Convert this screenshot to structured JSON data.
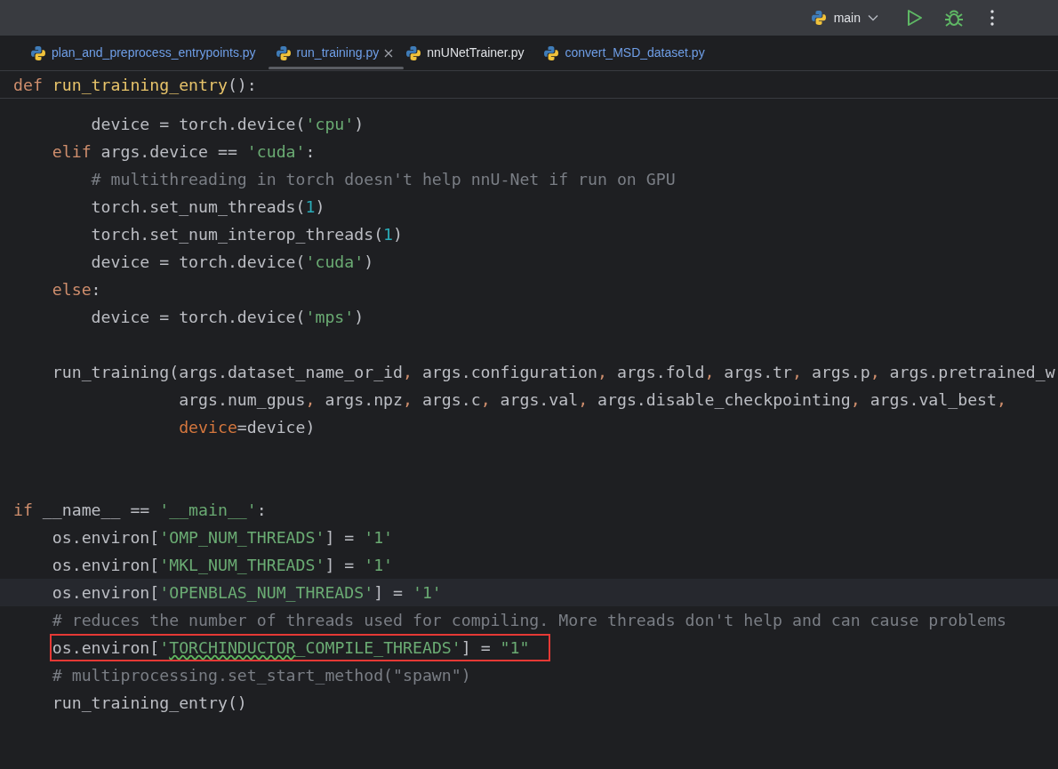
{
  "toolbar": {
    "run_config": "main"
  },
  "tabs": [
    {
      "label": "plan_and_preprocess_entrypoints.py",
      "selected": false,
      "closable": false,
      "color": "#6f9fe8"
    },
    {
      "label": "run_training.py",
      "selected": true,
      "closable": true,
      "color": "#6f9fe8"
    },
    {
      "label": "nnUNetTrainer.py",
      "selected": false,
      "closable": false,
      "color": "#dfe1e5"
    },
    {
      "label": "convert_MSD_dataset.py",
      "selected": false,
      "closable": false,
      "color": "#6f9fe8"
    }
  ],
  "sticky_header": [
    {
      "kind": "kw",
      "text": "def"
    },
    {
      "kind": "fn",
      "text": " run_training_entry"
    },
    {
      "kind": "plain",
      "text": "():"
    }
  ],
  "code_lines": [
    {
      "current": false,
      "boxed": false,
      "tokens": [
        {
          "kind": "plain",
          "text": "        device = torch.device("
        },
        {
          "kind": "str",
          "text": "'cpu'"
        },
        {
          "kind": "plain",
          "text": ")"
        }
      ]
    },
    {
      "current": false,
      "boxed": false,
      "tokens": [
        {
          "kind": "kw",
          "text": "    elif"
        },
        {
          "kind": "plain",
          "text": " args.device == "
        },
        {
          "kind": "str",
          "text": "'cuda'"
        },
        {
          "kind": "plain",
          "text": ":"
        }
      ]
    },
    {
      "current": false,
      "boxed": false,
      "tokens": [
        {
          "kind": "comment",
          "text": "        # multithreading in torch doesn't help nnU-Net if run on GPU"
        }
      ]
    },
    {
      "current": false,
      "boxed": false,
      "tokens": [
        {
          "kind": "plain",
          "text": "        torch.set_num_threads("
        },
        {
          "kind": "num",
          "text": "1"
        },
        {
          "kind": "plain",
          "text": ")"
        }
      ]
    },
    {
      "current": false,
      "boxed": false,
      "tokens": [
        {
          "kind": "plain",
          "text": "        torch.set_num_interop_threads("
        },
        {
          "kind": "num",
          "text": "1"
        },
        {
          "kind": "plain",
          "text": ")"
        }
      ]
    },
    {
      "current": false,
      "boxed": false,
      "tokens": [
        {
          "kind": "plain",
          "text": "        device = torch.device("
        },
        {
          "kind": "str",
          "text": "'cuda'"
        },
        {
          "kind": "plain",
          "text": ")"
        }
      ]
    },
    {
      "current": false,
      "boxed": false,
      "tokens": [
        {
          "kind": "kw",
          "text": "    else"
        },
        {
          "kind": "plain",
          "text": ":"
        }
      ]
    },
    {
      "current": false,
      "boxed": false,
      "tokens": [
        {
          "kind": "plain",
          "text": "        device = torch.device("
        },
        {
          "kind": "str",
          "text": "'mps'"
        },
        {
          "kind": "plain",
          "text": ")"
        }
      ]
    },
    {
      "current": false,
      "boxed": false
    },
    {
      "current": false,
      "boxed": false,
      "tokens": [
        {
          "kind": "plain",
          "text": "    run_training(args.dataset_name_or_id"
        },
        {
          "kind": "comma",
          "text": ","
        },
        {
          "kind": "plain",
          "text": " args.configuration"
        },
        {
          "kind": "comma",
          "text": ","
        },
        {
          "kind": "plain",
          "text": " args.fold"
        },
        {
          "kind": "comma",
          "text": ","
        },
        {
          "kind": "plain",
          "text": " args.tr"
        },
        {
          "kind": "comma",
          "text": ","
        },
        {
          "kind": "plain",
          "text": " args.p"
        },
        {
          "kind": "comma",
          "text": ","
        },
        {
          "kind": "plain",
          "text": " args.pretrained_w"
        }
      ]
    },
    {
      "current": false,
      "boxed": false,
      "tokens": [
        {
          "kind": "plain",
          "text": "                 args.num_gpus"
        },
        {
          "kind": "comma",
          "text": ","
        },
        {
          "kind": "plain",
          "text": " args.npz"
        },
        {
          "kind": "comma",
          "text": ","
        },
        {
          "kind": "plain",
          "text": " args.c"
        },
        {
          "kind": "comma",
          "text": ","
        },
        {
          "kind": "plain",
          "text": " args.val"
        },
        {
          "kind": "comma",
          "text": ","
        },
        {
          "kind": "plain",
          "text": " args.disable_checkpointing"
        },
        {
          "kind": "comma",
          "text": ","
        },
        {
          "kind": "plain",
          "text": " args.val_best"
        },
        {
          "kind": "comma",
          "text": ","
        }
      ]
    },
    {
      "current": false,
      "boxed": false,
      "tokens": [
        {
          "kind": "param",
          "text": "                 device"
        },
        {
          "kind": "plain",
          "text": "=device)"
        }
      ]
    },
    {
      "current": false,
      "boxed": false
    },
    {
      "current": false,
      "boxed": false
    },
    {
      "current": false,
      "boxed": false,
      "tokens": [
        {
          "kind": "kw",
          "text": "if"
        },
        {
          "kind": "plain",
          "text": " __name__ == "
        },
        {
          "kind": "str",
          "text": "'__main__'"
        },
        {
          "kind": "plain",
          "text": ":"
        }
      ]
    },
    {
      "current": false,
      "boxed": false,
      "tokens": [
        {
          "kind": "plain",
          "text": "    os.environ["
        },
        {
          "kind": "str",
          "text": "'OMP_NUM_THREADS'"
        },
        {
          "kind": "plain",
          "text": "] = "
        },
        {
          "kind": "str",
          "text": "'1'"
        }
      ]
    },
    {
      "current": false,
      "boxed": false,
      "tokens": [
        {
          "kind": "plain",
          "text": "    os.environ["
        },
        {
          "kind": "str",
          "text": "'MKL_NUM_THREADS'"
        },
        {
          "kind": "plain",
          "text": "] = "
        },
        {
          "kind": "str",
          "text": "'1'"
        }
      ]
    },
    {
      "current": true,
      "boxed": false,
      "tokens": [
        {
          "kind": "plain",
          "text": "    os.environ["
        },
        {
          "kind": "str",
          "text": "'OPENBLAS_NUM_THREADS'"
        },
        {
          "kind": "plain",
          "text": "] = "
        },
        {
          "kind": "str",
          "text": "'1'"
        }
      ]
    },
    {
      "current": false,
      "boxed": false,
      "tokens": [
        {
          "kind": "comment",
          "text": "    # reduces the number of threads used for compiling. More threads don't help and can cause problems"
        }
      ]
    },
    {
      "current": false,
      "boxed": true,
      "tokens": [
        {
          "kind": "plain",
          "text": "    os.environ["
        },
        {
          "kind": "str",
          "text": "'"
        },
        {
          "kind": "misspelled",
          "text": "TORCHINDUCTOR"
        },
        {
          "kind": "str",
          "text": "_COMPILE_THREADS'"
        },
        {
          "kind": "plain",
          "text": "] = "
        },
        {
          "kind": "str",
          "text": "\"1\""
        }
      ]
    },
    {
      "current": false,
      "boxed": false,
      "tokens": [
        {
          "kind": "comment",
          "text": "    # multiprocessing.set_start_method(\"spawn\")"
        }
      ]
    },
    {
      "current": false,
      "boxed": false,
      "tokens": [
        {
          "kind": "plain",
          "text": "    run_training_entry()"
        }
      ]
    }
  ]
}
